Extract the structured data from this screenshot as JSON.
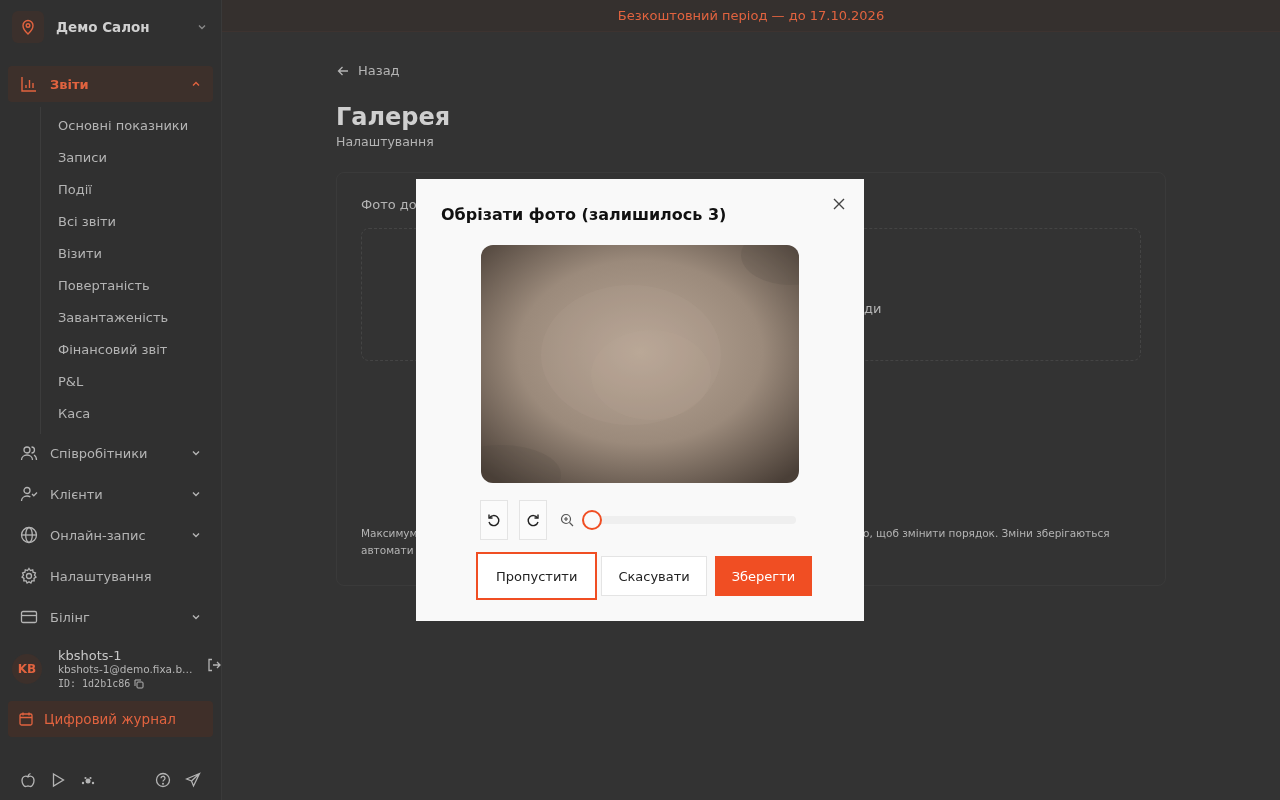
{
  "banner": {
    "text": "Безкоштовний період — до 17.10.2026"
  },
  "sidebar": {
    "salon": {
      "name": "Демо Салон"
    },
    "nav": [
      {
        "label": "Звіти",
        "kind": "group",
        "selected": true,
        "expanded": true,
        "children": [
          {
            "label": "Основні показники"
          },
          {
            "label": "Записи"
          },
          {
            "label": "Події"
          },
          {
            "label": "Всі звіти"
          },
          {
            "label": "Візити"
          },
          {
            "label": "Повертаність"
          },
          {
            "label": "Завантаженість"
          },
          {
            "label": "Фінансовий звіт"
          },
          {
            "label": "P&L"
          },
          {
            "label": "Каса"
          }
        ]
      },
      {
        "label": "Співробітники",
        "kind": "group",
        "selected": false,
        "expanded": false
      },
      {
        "label": "Клієнти",
        "kind": "group",
        "selected": false,
        "expanded": false
      },
      {
        "label": "Онлайн-запис",
        "kind": "group",
        "selected": false,
        "expanded": false
      },
      {
        "label": "Налаштування",
        "kind": "link",
        "selected": false
      },
      {
        "label": "Білінг",
        "kind": "group",
        "selected": false,
        "expanded": false
      }
    ],
    "user": {
      "initials": "KB",
      "name": "kbshots-1",
      "email": "kbshots-1@demo.fixa.b…",
      "id": "ID: 1d2b1c86"
    },
    "journal_button": {
      "label": "Цифровий журнал"
    }
  },
  "page": {
    "back": "Назад",
    "title": "Галерея",
    "subtitle": "Налаштування",
    "card": {
      "label_fragment": "Фото до",
      "upload_fragment": "ди",
      "note_left": [
        "Максимум",
        "автомати"
      ],
      "note_right": "о, щоб змінити порядок. Зміни зберігаються"
    }
  },
  "dialog": {
    "title": "Обрізати фото (залишилось 3)",
    "zoom": {
      "level": 0
    },
    "buttons": [
      {
        "label": "Пропустити",
        "kind": "outline",
        "focused": true
      },
      {
        "label": "Скасувати",
        "kind": "secondary",
        "focused": false
      },
      {
        "label": "Зберегти",
        "kind": "primary",
        "focused": false
      }
    ]
  }
}
